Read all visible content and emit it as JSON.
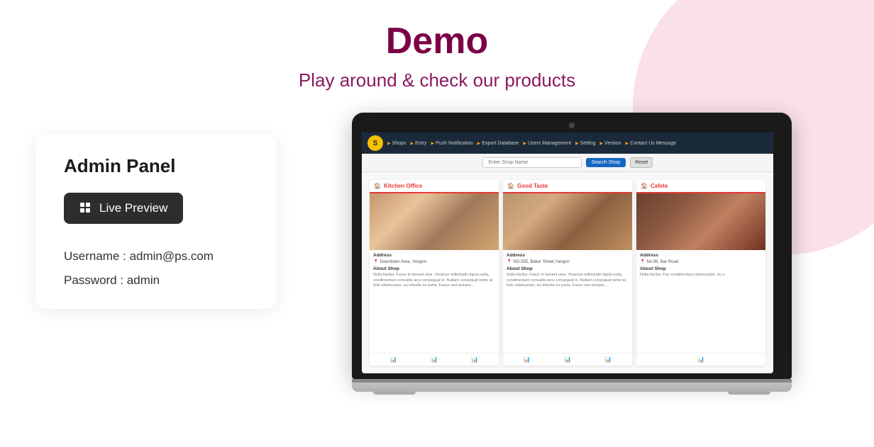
{
  "header": {
    "title": "Demo",
    "subtitle": "Play around & check our products"
  },
  "left_panel": {
    "admin_label": "Admin Panel",
    "live_preview_btn": "Live Preview",
    "username_label": "Username : admin@ps.com",
    "password_label": "Password : admin"
  },
  "app": {
    "navbar": {
      "logo_text": "S",
      "items": [
        "Shops",
        "Entry",
        "Push Notification",
        "Export Database",
        "Users Management",
        "Setting",
        "Version",
        "Contact Us Message"
      ]
    },
    "search": {
      "placeholder": "Enter Shop Name",
      "search_btn": "Search Shop",
      "reset_btn": "Reset"
    },
    "cards": [
      {
        "title": "Kitchen Office",
        "address_label": "Address",
        "address": "Downtown Area, Yangon",
        "about_label": "About Shop",
        "about": "Nulla facilisi. Fusce in laoreet uma. Vivamus sollicitudin ligula nulla, condimentum convallis arcu consequat in. Nullam consequat tortor at felis ullamcorper, eu lobortis ex porta. Fusce sed semper..."
      },
      {
        "title": "Good Taste",
        "address_label": "Address",
        "address": "NO.555, Baker Street,Yangon",
        "about_label": "About Shop",
        "about": "Nulla facilisi. Fusce in laoreet uma. Vivamus sollicitudin ligula nulla, condimentum convallis arcu consequat in. Nullam consequat tortor at felis ullamcorper, eu lobortis ex porta. Fusce sed semper..."
      },
      {
        "title": "Cafete",
        "address_label": "Address",
        "address": "No.99, Bar Road",
        "about_label": "About Shop",
        "about": "Nulla facilisi. Fus condimentum ullamcorper, eu u"
      }
    ]
  },
  "colors": {
    "title": "#7b0045",
    "subtitle": "#8a1a5e",
    "navbar_bg": "#1a2a3a",
    "card_accent": "#e53935",
    "btn_primary": "#2d2d2d",
    "search_btn": "#1565c0"
  }
}
